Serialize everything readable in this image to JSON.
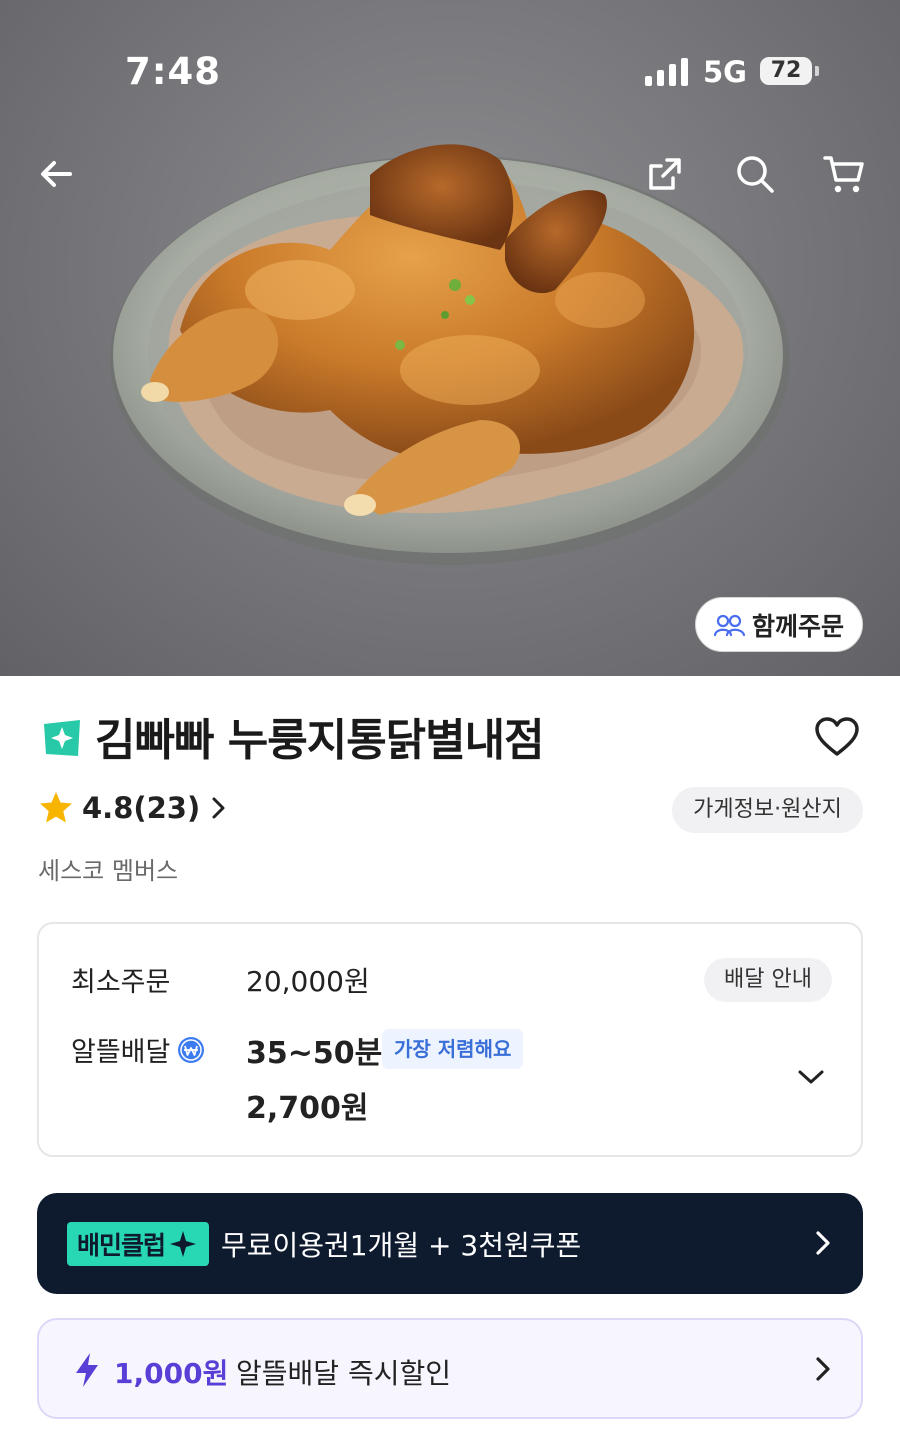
{
  "status_bar": {
    "time": "7:48",
    "network": "5G",
    "battery": "72"
  },
  "hero": {
    "image_subject": "roast-chicken-on-nurungji-plate",
    "group_order_label": "함께주문"
  },
  "nav": {
    "icons": [
      "back-arrow-icon",
      "share-icon",
      "search-icon",
      "cart-icon"
    ]
  },
  "store": {
    "name": "김빠빠 누룽지통닭별내점",
    "rating": "4.8(23)",
    "info_button": "가게정보·원산지",
    "membership": "세스코 멤버스"
  },
  "delivery": {
    "min_order_label": "최소주문",
    "min_order_value": "20,000원",
    "guide_button": "배달 안내",
    "type_label": "알뜰배달",
    "time": "35~50분",
    "badge": "가장 저렴해요",
    "fee": "2,700원"
  },
  "club_banner": {
    "badge": "배민클럽",
    "text": "무료이용권1개월 + 3천원쿠폰"
  },
  "discount_banner": {
    "amount": "1,000원",
    "text": "알뜰배달 즉시할인"
  },
  "colors": {
    "brand_mint": "#28d7b3",
    "club_navy": "#0e1a2e",
    "discount_purple": "#5a3fd6",
    "badge_blue": "#3a6fd8",
    "star": "#f7b500"
  }
}
